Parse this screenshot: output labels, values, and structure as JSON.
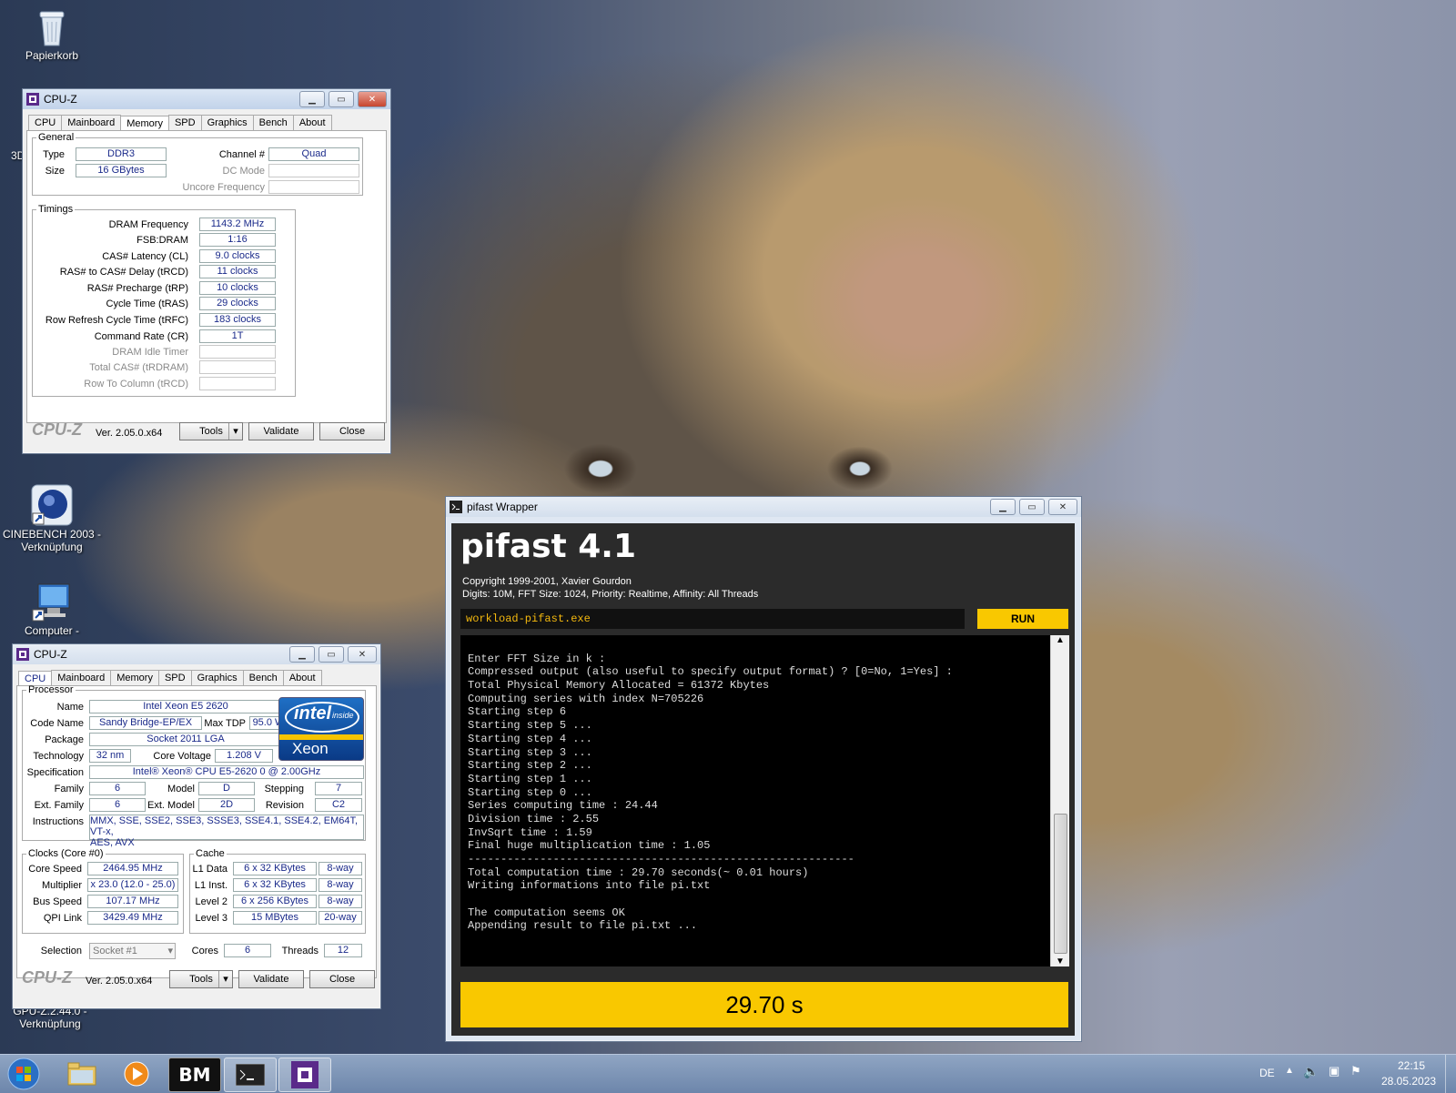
{
  "desktop": {
    "icons": [
      {
        "id": "recycle",
        "label": "Papierkorb"
      },
      {
        "id": "cinebench",
        "label": "CINEBENCH 2003 - Verknüpfung"
      },
      {
        "id": "computer",
        "label": "Computer -"
      },
      {
        "id": "gpuz",
        "label": "GPU-Z.2.44.0 - Verknüpfung"
      }
    ],
    "stray_text": "3D"
  },
  "cpuz_memory": {
    "title": "CPU-Z",
    "tabs": [
      "CPU",
      "Mainboard",
      "Memory",
      "SPD",
      "Graphics",
      "Bench",
      "About"
    ],
    "active_tab": "Memory",
    "general_legend": "General",
    "type_label": "Type",
    "type_value": "DDR3",
    "size_label": "Size",
    "size_value": "16 GBytes",
    "channel_label": "Channel #",
    "channel_value": "Quad",
    "dcmode_label": "DC Mode",
    "dcmode_value": "",
    "uncore_label": "Uncore Frequency",
    "uncore_value": "",
    "timings_legend": "Timings",
    "timings": [
      {
        "label": "DRAM Frequency",
        "value": "1143.2 MHz",
        "disabled": false
      },
      {
        "label": "FSB:DRAM",
        "value": "1:16",
        "disabled": false
      },
      {
        "label": "CAS# Latency (CL)",
        "value": "9.0 clocks",
        "disabled": false
      },
      {
        "label": "RAS# to CAS# Delay (tRCD)",
        "value": "11 clocks",
        "disabled": false
      },
      {
        "label": "RAS# Precharge (tRP)",
        "value": "10 clocks",
        "disabled": false
      },
      {
        "label": "Cycle Time (tRAS)",
        "value": "29 clocks",
        "disabled": false
      },
      {
        "label": "Row Refresh Cycle Time (tRFC)",
        "value": "183 clocks",
        "disabled": false
      },
      {
        "label": "Command Rate (CR)",
        "value": "1T",
        "disabled": false
      },
      {
        "label": "DRAM Idle Timer",
        "value": "",
        "disabled": true
      },
      {
        "label": "Total CAS# (tRDRAM)",
        "value": "",
        "disabled": true
      },
      {
        "label": "Row To Column (tRCD)",
        "value": "",
        "disabled": true
      }
    ],
    "logo": "CPU-Z",
    "version": "Ver. 2.05.0.x64",
    "tools_label": "Tools",
    "validate_label": "Validate",
    "close_label": "Close"
  },
  "cpuz_cpu": {
    "title": "CPU-Z",
    "tabs": [
      "CPU",
      "Mainboard",
      "Memory",
      "SPD",
      "Graphics",
      "Bench",
      "About"
    ],
    "active_tab": "CPU",
    "processor_legend": "Processor",
    "name_label": "Name",
    "name_value": "Intel Xeon E5 2620",
    "codename_label": "Code Name",
    "codename_value": "Sandy Bridge-EP/EX",
    "maxtdp_label": "Max TDP",
    "maxtdp_value": "95.0 W",
    "package_label": "Package",
    "package_value": "Socket 2011 LGA",
    "tech_label": "Technology",
    "tech_value": "32 nm",
    "voltage_label": "Core Voltage",
    "voltage_value": "1.208 V",
    "spec_label": "Specification",
    "spec_value": "Intel® Xeon® CPU E5-2620 0 @ 2.00GHz",
    "family_label": "Family",
    "family_value": "6",
    "model_label": "Model",
    "model_value": "D",
    "stepping_label": "Stepping",
    "stepping_value": "7",
    "extfamily_label": "Ext. Family",
    "extfamily_value": "6",
    "extmodel_label": "Ext. Model",
    "extmodel_value": "2D",
    "revision_label": "Revision",
    "revision_value": "C2",
    "instr_label": "Instructions",
    "instr_line1": "MMX, SSE, SSE2, SSE3, SSSE3, SSE4.1, SSE4.2, EM64T, VT-x,",
    "instr_line2": "AES, AVX",
    "badge": {
      "brand": "intel",
      "inside": "inside",
      "product": "Xeon"
    },
    "clocks_legend": "Clocks (Core #0)",
    "corespeed_label": "Core Speed",
    "corespeed_value": "2464.95 MHz",
    "multiplier_label": "Multiplier",
    "multiplier_value": "x 23.0 (12.0 - 25.0)",
    "busspeed_label": "Bus Speed",
    "busspeed_value": "107.17 MHz",
    "qpi_label": "QPI Link",
    "qpi_value": "3429.49 MHz",
    "cache_legend": "Cache",
    "cache": [
      {
        "label": "L1 Data",
        "size": "6 x 32 KBytes",
        "way": "8-way"
      },
      {
        "label": "L1 Inst.",
        "size": "6 x 32 KBytes",
        "way": "8-way"
      },
      {
        "label": "Level 2",
        "size": "6 x 256 KBytes",
        "way": "8-way"
      },
      {
        "label": "Level 3",
        "size": "15 MBytes",
        "way": "20-way"
      }
    ],
    "selection_label": "Selection",
    "selection_value": "Socket #1",
    "cores_label": "Cores",
    "cores_value": "6",
    "threads_label": "Threads",
    "threads_value": "12",
    "logo": "CPU-Z",
    "version": "Ver. 2.05.0.x64",
    "tools_label": "Tools",
    "validate_label": "Validate",
    "close_label": "Close"
  },
  "pifast": {
    "window_title": "pifast Wrapper",
    "heading": "pifast 4.1",
    "copyright": "Copyright 1999-2001, Xavier Gourdon",
    "settings": "Digits: 10M, FFT Size: 1024, Priority: Realtime, Affinity: All Threads",
    "exe": "workload-pifast.exe",
    "run_label": "RUN",
    "console": [
      "",
      "Enter FFT Size in k :",
      "Compressed output (also useful to specify output format) ? [0=No, 1=Yes] :",
      "Total Physical Memory Allocated = 61372 Kbytes",
      "Computing series with index N=705226",
      "Starting step 6",
      "Starting step 5 ...",
      "Starting step 4 ...",
      "Starting step 3 ...",
      "Starting step 2 ...",
      "Starting step 1 ...",
      "Starting step 0 ...",
      "Series computing time : 24.44",
      "Division time : 2.55",
      "InvSqrt time : 1.59",
      "Final huge multiplication time : 1.05",
      "-----------------------------------------------------------",
      "Total computation time : 29.70 seconds(~ 0.01 hours)",
      "Writing informations into file pi.txt",
      "",
      "The computation seems OK",
      "Appending result to file pi.txt ..."
    ],
    "result": "29.70 s"
  },
  "taskbar": {
    "apps": [
      {
        "id": "start"
      },
      {
        "id": "explorer"
      },
      {
        "id": "media-player"
      },
      {
        "id": "benchmate",
        "label": "BM"
      },
      {
        "id": "console"
      },
      {
        "id": "cpuz"
      }
    ],
    "language": "DE",
    "time": "22:15",
    "date": "28.05.2023"
  }
}
